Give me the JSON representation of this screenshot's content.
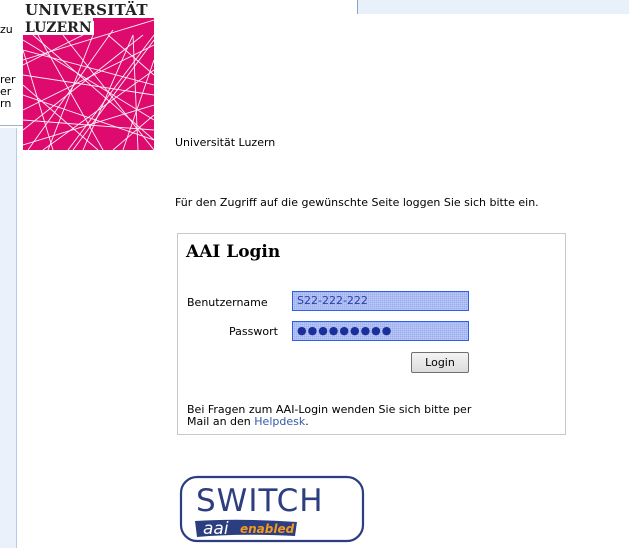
{
  "background_fragments": {
    "lines": [
      "zu",
      "rer",
      "er",
      "rn"
    ]
  },
  "logo": {
    "title": "UNIVERSITÄT",
    "subtitle": "LUZERN"
  },
  "university_name": "Universität Luzern",
  "intro_text": "Für den Zugriff auf die gewünschte Seite loggen Sie sich bitte ein.",
  "login": {
    "title": "AAI Login",
    "username_label": "Benutzername",
    "username_value": "S22-222-222",
    "password_label": "Passwort",
    "password_mask": "●●●●●●●●●",
    "button_label": "Login",
    "help_text_1": "Bei Fragen zum AAI-Login wenden Sie sich bitte per",
    "help_text_2": "Mail an den ",
    "help_link": "Helpdesk",
    "help_text_3": "."
  },
  "badge": {
    "word": "SWITCH",
    "aai": "aai",
    "enabled": "enabled"
  },
  "colors": {
    "logo_magenta": "#de0a6e",
    "input_fill": "#9aaef0",
    "input_border": "#2f5ee8",
    "badge_navy": "#2c3e80",
    "badge_orange": "#f49a1e"
  }
}
